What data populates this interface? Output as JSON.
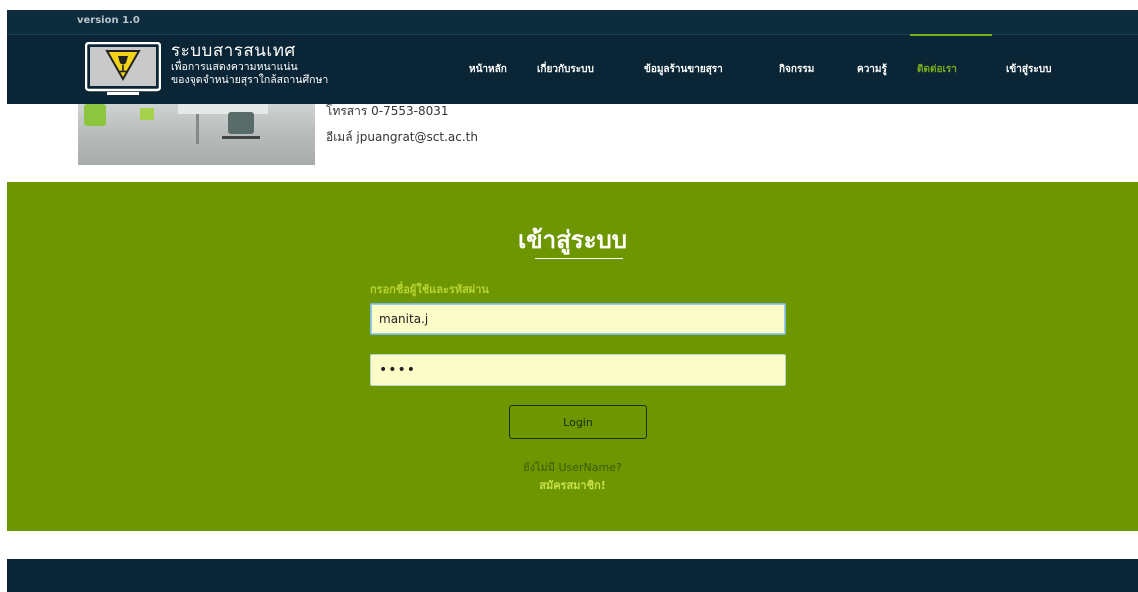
{
  "header": {
    "version": "version 1.0",
    "brand_title": "ระบบสารสนเทศ",
    "brand_sub1": "เพื่อการแสดงความหนาแน่น",
    "brand_sub2": "ของจุดจำหน่ายสุราใกล้สถานศึกษา",
    "logo_icon": "monitor-wine-warning-icon"
  },
  "nav": {
    "items": [
      {
        "label": "หน้าหลัก",
        "active": false
      },
      {
        "label": "เกี่ยวกับระบบ",
        "active": false
      },
      {
        "label": "ข้อมูลร้านขายสุรา",
        "active": false
      },
      {
        "label": "กิจกรรม",
        "active": false
      },
      {
        "label": "ความรู้",
        "active": false
      },
      {
        "label": "ติดต่อเรา",
        "active": true
      },
      {
        "label": "เข้าสู่ระบบ",
        "active": false
      }
    ]
  },
  "contact": {
    "fax": "โทรสาร 0-7553-8031",
    "email": "อีเมล์ jpuangrat@sct.ac.th"
  },
  "login": {
    "title": "เข้าสู่ระบบ",
    "hint": "กรอกชื่อผู้ใช้และรหัสผ่าน",
    "username_value": "manita.j",
    "password_value": "••••",
    "login_button": "Login",
    "no_account": "ยังไม่มี UserName?",
    "signup_link": "สมัครสมาชิก!"
  },
  "colors": {
    "navbar": "#0a2535",
    "accent": "#7aab1a",
    "login_bg": "#6d9600",
    "input_bg": "#fbfcc8"
  }
}
